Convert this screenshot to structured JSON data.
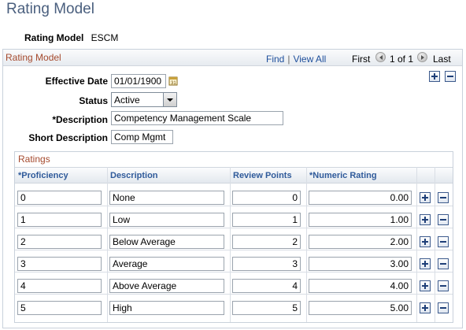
{
  "page": {
    "title": "Rating Model"
  },
  "model": {
    "label": "Rating Model",
    "value": "ESCM"
  },
  "section": {
    "title": "Rating Model",
    "find": "Find",
    "view_all": "View All",
    "first": "First",
    "page_range": "1 of 1",
    "last": "Last"
  },
  "fields": {
    "effective_date": {
      "label": "Effective Date",
      "value": "01/01/1900"
    },
    "status": {
      "label": "Status",
      "value": "Active"
    },
    "description": {
      "label": "*Description",
      "value": "Competency Management Scale"
    },
    "short_description": {
      "label": "Short Description",
      "value": "Comp Mgmt"
    }
  },
  "ratings": {
    "title": "Ratings",
    "columns": [
      "*Proficiency",
      "Description",
      "Review Points",
      "*Numeric Rating"
    ],
    "rows": [
      {
        "proficiency": "0",
        "description": "None",
        "review_points": "0",
        "numeric_rating": "0.00"
      },
      {
        "proficiency": "1",
        "description": "Low",
        "review_points": "1",
        "numeric_rating": "1.00"
      },
      {
        "proficiency": "2",
        "description": "Below Average",
        "review_points": "2",
        "numeric_rating": "2.00"
      },
      {
        "proficiency": "3",
        "description": "Average",
        "review_points": "3",
        "numeric_rating": "3.00"
      },
      {
        "proficiency": "4",
        "description": "Above Average",
        "review_points": "4",
        "numeric_rating": "4.00"
      },
      {
        "proficiency": "5",
        "description": "High",
        "review_points": "5",
        "numeric_rating": "5.00"
      }
    ]
  },
  "icons": {
    "add": "plus-icon",
    "delete": "minus-icon",
    "calendar": "calendar-icon",
    "prev": "left-arrow-icon",
    "next": "right-arrow-icon"
  },
  "colors": {
    "title": "#4a5f7e",
    "section_title": "#a54a2e",
    "link": "#1e4f9c",
    "header_text": "#2f5a9a"
  }
}
